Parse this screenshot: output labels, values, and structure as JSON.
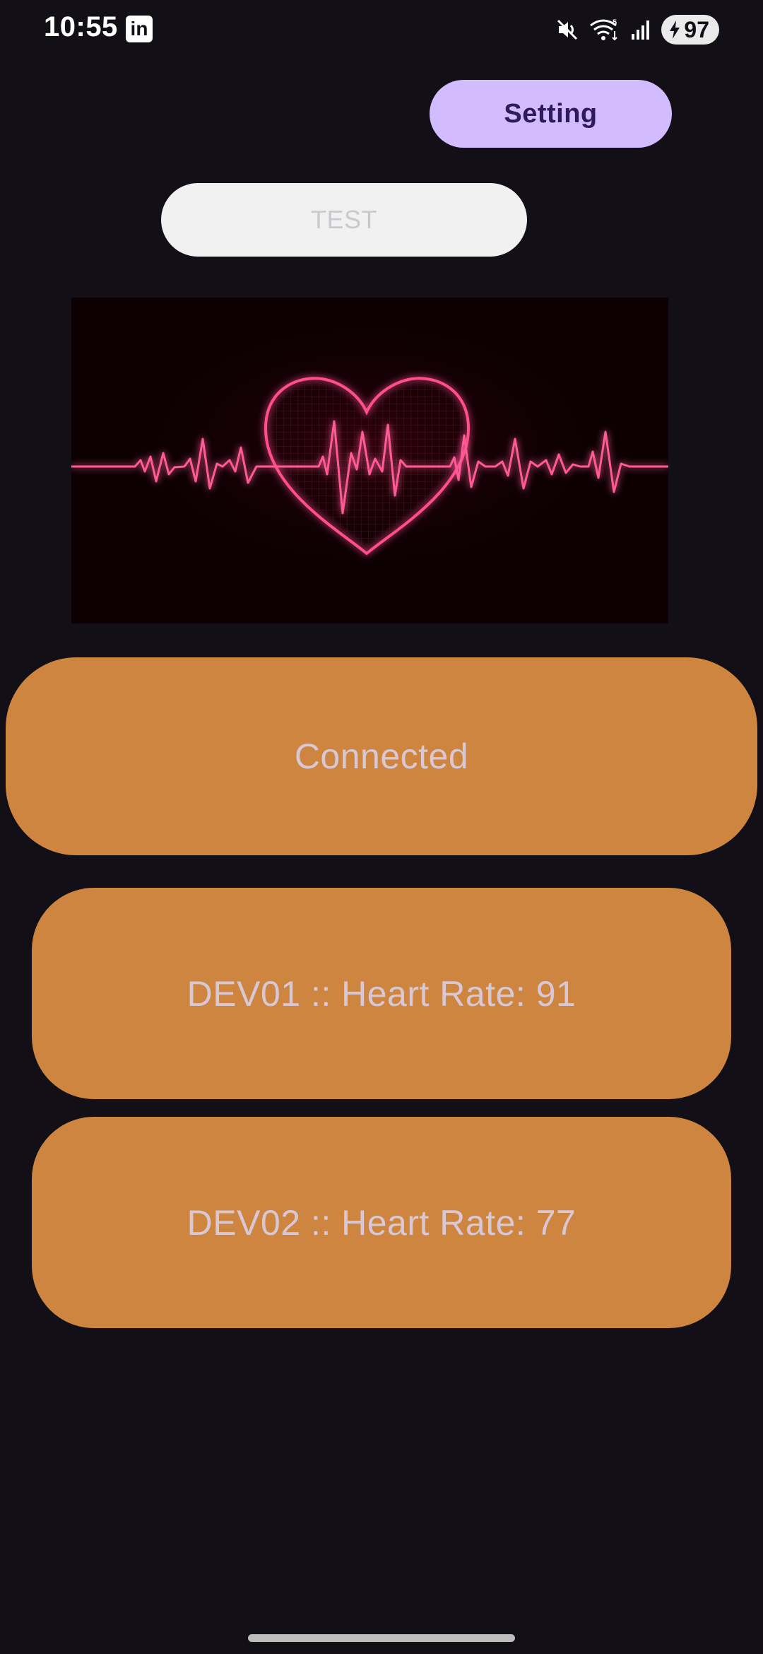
{
  "status_bar": {
    "time": "10:55",
    "notification_app_icon": "linkedin-icon",
    "battery_level": "97",
    "icons": [
      "mute-icon",
      "wifi-5-icon",
      "cellular-signal-icon",
      "charging-bolt-icon"
    ]
  },
  "header": {
    "setting_label": "Setting"
  },
  "test_button": {
    "label": "TEST"
  },
  "hero_image": {
    "subject": "heart-ecg-icon"
  },
  "connection": {
    "status_text": "Connected"
  },
  "devices": [
    {
      "text": "DEV01 :: Heart Rate: 91"
    },
    {
      "text": "DEV02 :: Heart Rate: 77"
    }
  ],
  "colors": {
    "background": "#121016",
    "setting_button": "#d2bcff",
    "setting_text": "#2e1a5c",
    "test_button": "#f1f1f1",
    "card": "#cd853f",
    "card_text": "#d8c8d6",
    "ecg_neon": "#ff4d8d"
  }
}
